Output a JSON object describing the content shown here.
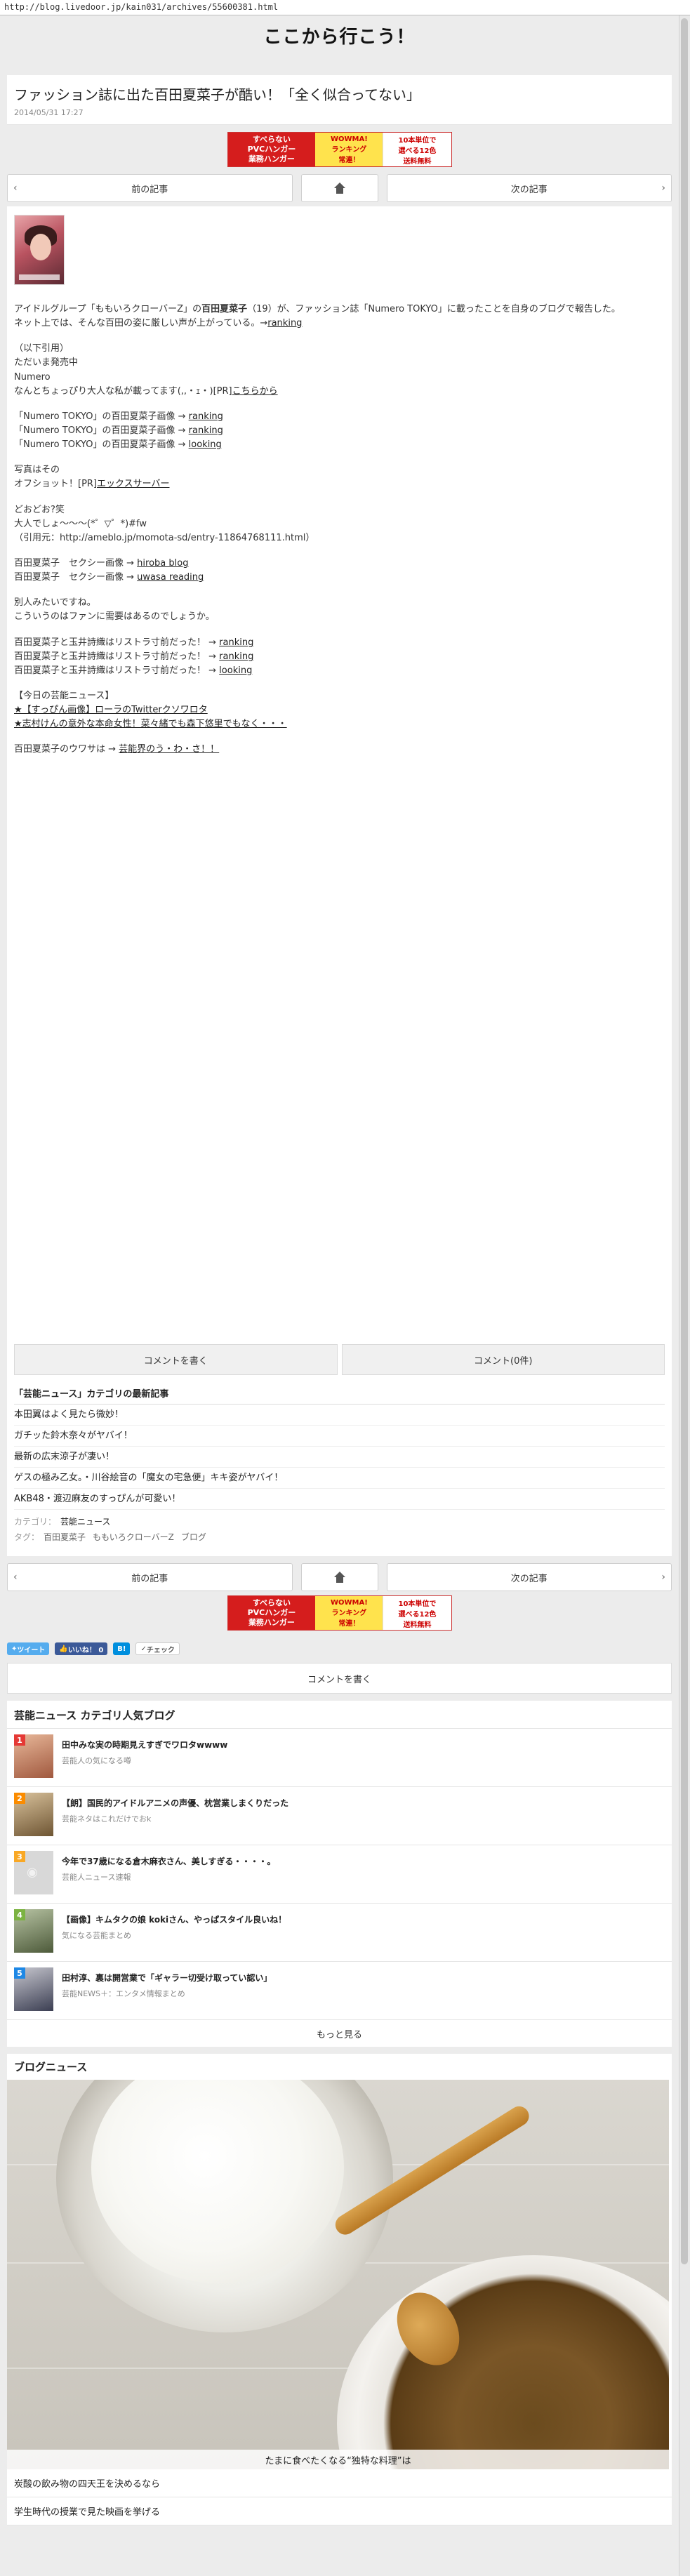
{
  "url": "http://blog.livedoor.jp/kain031/archives/55600381.html",
  "site": {
    "title": "ここから行こう！"
  },
  "article": {
    "title": "ファッション誌に出た百田夏菜子が酷い！「全く似合ってない」",
    "date": "2014/05/31 17:27"
  },
  "banner": {
    "left_line1": "すべらない",
    "left_line2": "PVCハンガー",
    "left_line3": "業務ハンガー",
    "mid_line1": "WOWMA!",
    "mid_line2": "ランキング",
    "mid_line3": "常連！",
    "right_line1": "10本単位で",
    "right_line2": "選べる12色",
    "right_line3": "送料無料"
  },
  "pager": {
    "prev": "前の記事",
    "next": "次の記事"
  },
  "body": {
    "intro_a": "アイドルグループ「ももいろクローバーZ」の",
    "intro_name": "百田夏菜子",
    "intro_b": "（19）が、ファッション誌「Numero TOKYO」に載ったことを自身のブログで報告した。",
    "intro_c": "ネット上では、そんな百田の姿に厳しい声が上がっている。→",
    "intro_link": "ranking",
    "quote1": "（以下引用）",
    "quote2": "ただいま発売中",
    "quote3": "Numero",
    "quote4": "なんとちょっぴり大人な私が載ってます(,,・ｪ・)[PR]",
    "quote4_link": "こちらから",
    "img_lines": [
      {
        "text": "「Numero TOKYO」の百田夏菜子画像 →",
        "link": "ranking"
      },
      {
        "text": "「Numero TOKYO」の百田夏菜子画像 →",
        "link": "ranking"
      },
      {
        "text": "「Numero TOKYO」の百田夏菜子画像 →",
        "link": "looking"
      }
    ],
    "photo1": "写真はその",
    "photo2": "オフショット！[PR]",
    "photo2_link": "エックスサーバー",
    "ending1": "どおどお?笑",
    "ending2": "大人でしょ～～～(*゜▽゜*)#fw",
    "ending3": "（引用元：http://ameblo.jp/momota-sd/entry-11864768111.html）",
    "sexy": [
      {
        "text": "百田夏菜子　セクシー画像 →",
        "link": "hiroba blog"
      },
      {
        "text": "百田夏菜子　セクシー画像 →",
        "link": "uwasa reading"
      }
    ],
    "other1": "別人みたいですね。",
    "other2": "こういうのはファンに需要はあるのでしょうか。",
    "restra": [
      {
        "text": "百田夏菜子と玉井詩織はリストラ寸前だった！ →",
        "link": "ranking"
      },
      {
        "text": "百田夏菜子と玉井詩織はリストラ寸前だった！ →",
        "link": "ranking"
      },
      {
        "text": "百田夏菜子と玉井詩織はリストラ寸前だった！ →",
        "link": "looking"
      }
    ],
    "today_h": "【今日の芸能ニュース】",
    "today_items": [
      "★【すっぴん画像】ローラのTwitterクソワロタ",
      "★志村けんの意外な本命女性！菜々緒でも森下悠里でもなく・・・"
    ],
    "rumor_a": "百田夏菜子のウワサは →",
    "rumor_link": "芸能界のう・わ・さ！！"
  },
  "comment": {
    "write": "コメントを書く",
    "count": "コメント(0件)"
  },
  "latest": {
    "heading": "「芸能ニュース」カテゴリの最新記事",
    "items": [
      "本田翼はよく見たら微妙！",
      "ガチッた鈴木奈々がヤバイ！",
      "最新の広末涼子が凄い！",
      "ゲスの極み乙女。・川谷絵音の「魔女の宅急便」キキ姿がヤバイ！",
      "AKB48・渡辺麻友のすっぴんが可愛い！"
    ]
  },
  "meta": {
    "category_label": "カテゴリ：",
    "category": "芸能ニュース",
    "tag_label": "タグ：",
    "tags": [
      "百田夏菜子",
      "ももいろクローバーZ",
      "ブログ"
    ]
  },
  "social": {
    "tweet": "ツイート",
    "like": "いいね！ 0",
    "hatena": "B!",
    "check": "チェック"
  },
  "ranking": {
    "heading": "芸能ニュース カテゴリ人気ブログ",
    "items": [
      {
        "rank": "1",
        "title": "田中みな実の時期見えすぎでワロタwwww",
        "source": "芸能人の気になる噂",
        "color": "#e53935"
      },
      {
        "rank": "2",
        "title": "【朗】国民的アイドルアニメの声優、枕営業しまくりだった",
        "source": "芸能ネタはこれだけでおk",
        "color": "#fb8c00"
      },
      {
        "rank": "3",
        "title": "今年で37歳になる倉木麻衣さん、美しすぎる・・・・。",
        "source": "芸能人ニュース速報",
        "color": "#f9a825"
      },
      {
        "rank": "4",
        "title": "【画像】キムタクの娘 kokiさん、やっぱスタイル良いね！",
        "source": "気になる芸能まとめ",
        "color": "#7cb342"
      },
      {
        "rank": "5",
        "title": "田村淳、裏は開営業で「ギャラー切受け取ってい認い」",
        "source": "芸能NEWS＋：エンタメ情報まとめ",
        "color": "#1e88e5"
      }
    ],
    "more": "もっと見る"
  },
  "blog_news": {
    "heading": "ブログニュース",
    "caption": "たまに食べたくなる“独特な料理”は",
    "lines": [
      "炭酸の飲み物の四天王を決めるなら",
      "学生時代の授業で見た映画を挙げる"
    ]
  },
  "colors": {
    "frame_bg": "#ececec",
    "twitter": "#55acee",
    "facebook": "#3b5998",
    "banner_red": "#d51d1d"
  }
}
